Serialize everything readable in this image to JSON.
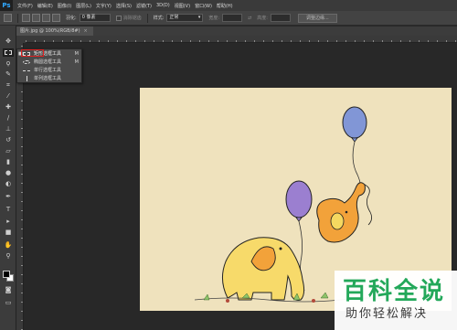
{
  "app": {
    "logo": "Ps"
  },
  "menu": [
    "文件(F)",
    "编辑(E)",
    "图像(I)",
    "图层(L)",
    "文字(Y)",
    "选择(S)",
    "滤镜(T)",
    "3D(D)",
    "视图(V)",
    "窗口(W)",
    "帮助(H)"
  ],
  "options": {
    "feather_label": "羽化:",
    "feather_value": "0 像素",
    "antialias_label": "消除锯齿",
    "style_label": "样式:",
    "style_value": "正常",
    "width_label": "宽度:",
    "height_label": "高度:",
    "refine_button": "调整边缘..."
  },
  "document": {
    "tab_title": "图片.jpg @ 100%(RGB/8#)",
    "close": "×"
  },
  "flyout": {
    "items": [
      {
        "label": "矩形选框工具",
        "key": "M",
        "selected": true
      },
      {
        "label": "椭圆选框工具",
        "key": "M",
        "selected": false
      },
      {
        "label": "单行选框工具",
        "key": "",
        "selected": false
      },
      {
        "label": "单列选框工具",
        "key": "",
        "selected": false
      }
    ],
    "marker": "■"
  },
  "colors": {
    "accent": "#31a8ff",
    "canvas_bg": "#efe2bd",
    "highlight": "#e02020",
    "watermark_green": "#23a85a"
  },
  "watermark": {
    "title": "百科全说",
    "subtitle": "助你轻松解决"
  },
  "tools": [
    "move-icon",
    "marquee-icon",
    "lasso-icon",
    "quick-select-icon",
    "crop-icon",
    "eyedropper-icon",
    "healing-icon",
    "brush-icon",
    "stamp-icon",
    "history-brush-icon",
    "eraser-icon",
    "gradient-icon",
    "blur-icon",
    "dodge-icon",
    "pen-icon",
    "type-icon",
    "path-select-icon",
    "shape-icon",
    "hand-icon",
    "zoom-icon"
  ]
}
